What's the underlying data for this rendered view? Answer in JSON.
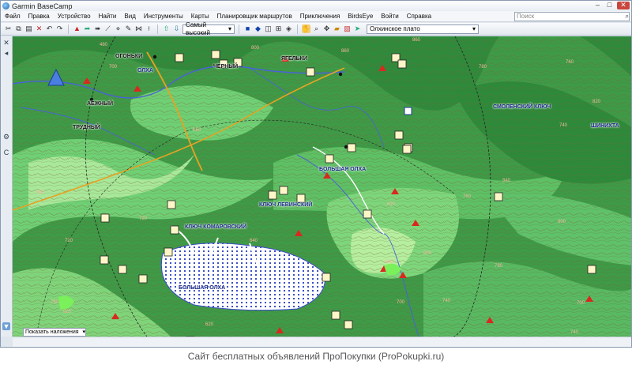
{
  "window": {
    "title": "Garmin BaseCamp"
  },
  "menu": [
    "Файл",
    "Правка",
    "Устройство",
    "Найти",
    "Вид",
    "Инструменты",
    "Карты",
    "Планировщик маршрутов",
    "Приключения",
    "BirdsEye",
    "Войти",
    "Справка"
  ],
  "search": {
    "placeholder": "Поиск"
  },
  "toolbar": {
    "detail_select": "Самый высокий",
    "map_select": "Олхинское плато"
  },
  "map": {
    "places": [
      "ОГОНЬКИ",
      "ОЛХА",
      "ЧЕРНЫЙ",
      "ЯГЕЛЬКИ",
      "АЕЖНЫЙ",
      "ТРУДНЫЙ",
      "БОЛЬШАЯ ОЛХА",
      "КЛЮЧ ЛЕВИНСКИЙ",
      "КЛЮЧ КОМАРОВСКИЙ",
      "СМОЛЕНСКИЙ КЛЮЧ",
      "ШИНИХТА"
    ],
    "elevations": [
      "480",
      "760",
      "780",
      "860",
      "820",
      "740",
      "720",
      "700",
      "660",
      "620",
      "880",
      "840",
      "600",
      "900",
      "640",
      "780",
      "740",
      "700",
      "720",
      "760",
      "820",
      "800",
      "860",
      "700",
      "640",
      "620",
      "760",
      "740"
    ]
  },
  "overlay": {
    "label": "Показать наложения"
  },
  "footer": {
    "text": "Сайт бесплатных объявлений ПроПокупки (ProPokupki.ru)"
  }
}
